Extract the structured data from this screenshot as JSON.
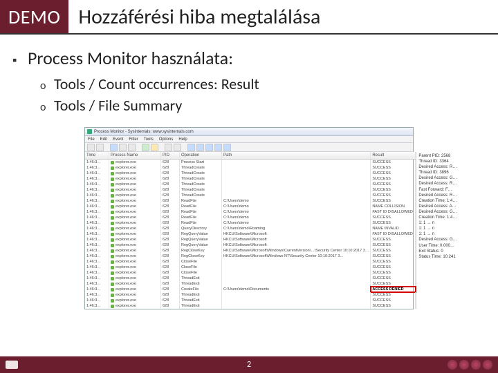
{
  "title": {
    "demo_badge": "DEMO",
    "text": "Hozzáférési hiba megtalálása"
  },
  "bullets": {
    "l1": "Process Monitor használata:",
    "l2a": "Tools / Count occurrences: Result",
    "l2b": "Tools / File Summary"
  },
  "procmon": {
    "window_title": "Process Monitor - Sysinternals: www.sysinternals.com",
    "menus": [
      "File",
      "Edit",
      "Event",
      "Filter",
      "Tools",
      "Options",
      "Help"
    ],
    "columns": {
      "time": "Time",
      "process": "Process Name",
      "pid": "PID",
      "op": "Operation",
      "path": "Path",
      "result": "Result"
    },
    "rows": [
      {
        "time": "1:46:3…",
        "proc": "explorer.exe",
        "pid": "628",
        "op": "Process Start",
        "path": "",
        "res": "SUCCESS"
      },
      {
        "time": "1:46:3…",
        "proc": "explorer.exe",
        "pid": "628",
        "op": "ThreadCreate",
        "path": "",
        "res": "SUCCESS"
      },
      {
        "time": "1:46:3…",
        "proc": "explorer.exe",
        "pid": "628",
        "op": "ThreadCreate",
        "path": "",
        "res": "SUCCESS"
      },
      {
        "time": "1:46:3…",
        "proc": "explorer.exe",
        "pid": "628",
        "op": "ThreadCreate",
        "path": "",
        "res": "SUCCESS"
      },
      {
        "time": "1:46:3…",
        "proc": "explorer.exe",
        "pid": "628",
        "op": "ThreadCreate",
        "path": "",
        "res": "SUCCESS"
      },
      {
        "time": "1:46:3…",
        "proc": "explorer.exe",
        "pid": "628",
        "op": "ThreadCreate",
        "path": "",
        "res": "SUCCESS"
      },
      {
        "time": "1:46:3…",
        "proc": "explorer.exe",
        "pid": "628",
        "op": "ThreadCreate",
        "path": "",
        "res": "SUCCESS"
      },
      {
        "time": "1:46:3…",
        "proc": "explorer.exe",
        "pid": "628",
        "op": "ReadFile",
        "path": "C:\\Users\\demo",
        "res": "SUCCESS"
      },
      {
        "time": "1:46:3…",
        "proc": "explorer.exe",
        "pid": "628",
        "op": "ReadFile",
        "path": "C:\\Users\\demo",
        "res": "NAME COLLISION"
      },
      {
        "time": "1:46:3…",
        "proc": "explorer.exe",
        "pid": "628",
        "op": "ReadFile",
        "path": "C:\\Users\\demo",
        "res": "FAST IO DISALLOWED"
      },
      {
        "time": "1:46:3…",
        "proc": "explorer.exe",
        "pid": "628",
        "op": "ReadFile",
        "path": "C:\\Users\\demo",
        "res": "SUCCESS"
      },
      {
        "time": "1:46:3…",
        "proc": "explorer.exe",
        "pid": "628",
        "op": "ReadFile",
        "path": "C:\\Users\\demo",
        "res": "SUCCESS"
      },
      {
        "time": "1:46:3…",
        "proc": "explorer.exe",
        "pid": "628",
        "op": "QueryDirectory",
        "path": "C:\\Users\\demo\\Roaming",
        "res": "NAME INVALID"
      },
      {
        "time": "1:46:3…",
        "proc": "explorer.exe",
        "pid": "628",
        "op": "RegQueryValue",
        "path": "HKCU\\Software\\Microsoft",
        "res": "FAST IO DISALLOWED"
      },
      {
        "time": "1:46:3…",
        "proc": "explorer.exe",
        "pid": "628",
        "op": "RegQueryValue",
        "path": "HKCU\\Software\\Microsoft",
        "res": "SUCCESS"
      },
      {
        "time": "1:46:3…",
        "proc": "explorer.exe",
        "pid": "628",
        "op": "RegQueryValue",
        "path": "HKCU\\Software\\Microsoft",
        "res": "SUCCESS"
      },
      {
        "time": "1:46:3…",
        "proc": "explorer.exe",
        "pid": "628",
        "op": "RegCloseKey",
        "path": "HKCU\\Software\\Microsoft\\Windows\\CurrentVersion\\…\\Security Center 10:10:2017 3…",
        "res": "SUCCESS"
      },
      {
        "time": "1:46:3…",
        "proc": "explorer.exe",
        "pid": "628",
        "op": "RegCloseKey",
        "path": "HKCU\\Software\\Microsoft\\Windows NT\\Security Center 10:10:2017 3…",
        "res": "SUCCESS"
      },
      {
        "time": "1:46:3…",
        "proc": "explorer.exe",
        "pid": "628",
        "op": "CloseFile",
        "path": "",
        "res": "SUCCESS"
      },
      {
        "time": "1:46:3…",
        "proc": "explorer.exe",
        "pid": "628",
        "op": "CloseFile",
        "path": "",
        "res": "SUCCESS"
      },
      {
        "time": "1:46:3…",
        "proc": "explorer.exe",
        "pid": "628",
        "op": "CloseFile",
        "path": "",
        "res": "SUCCESS"
      },
      {
        "time": "1:46:3…",
        "proc": "explorer.exe",
        "pid": "628",
        "op": "ThreadExit",
        "path": "",
        "res": "SUCCESS"
      },
      {
        "time": "1:46:3…",
        "proc": "explorer.exe",
        "pid": "628",
        "op": "ThreadExit",
        "path": "",
        "res": "SUCCESS"
      },
      {
        "time": "1:46:3…",
        "proc": "explorer.exe",
        "pid": "628",
        "op": "CreateFile",
        "path": "C:\\Users\\demo\\Documents",
        "res": "ACCESS DENIED",
        "hl": true
      },
      {
        "time": "1:46:3…",
        "proc": "explorer.exe",
        "pid": "628",
        "op": "ThreadExit",
        "path": "",
        "res": "SUCCESS"
      },
      {
        "time": "1:46:3…",
        "proc": "explorer.exe",
        "pid": "628",
        "op": "ThreadExit",
        "path": "",
        "res": "SUCCESS"
      },
      {
        "time": "1:46:3…",
        "proc": "explorer.exe",
        "pid": "628",
        "op": "ThreadExit",
        "path": "",
        "res": "SUCCESS"
      }
    ],
    "detail": [
      "Parent PID: 2568",
      "Thread ID: 3364",
      "",
      "Desired Access: R…",
      "",
      "Thread ID: 3896",
      "Desired Access: G…",
      "",
      "Desired Access: R…",
      "Fast Forward: F…",
      "",
      "Desired Access: R…",
      "Creation Time: 1:4…",
      "",
      "Desired Access: A…",
      "Desired Access: G…",
      "Creation Time: 1:4…",
      "",
      "1: 1 → n",
      "1: 1 → n",
      "1: 1 → n",
      "",
      "Desired Access: G…",
      "User Time: 0.000…",
      "Exit Status: 0",
      "Status Time: 10:241"
    ]
  },
  "footer": {
    "page": "2"
  }
}
